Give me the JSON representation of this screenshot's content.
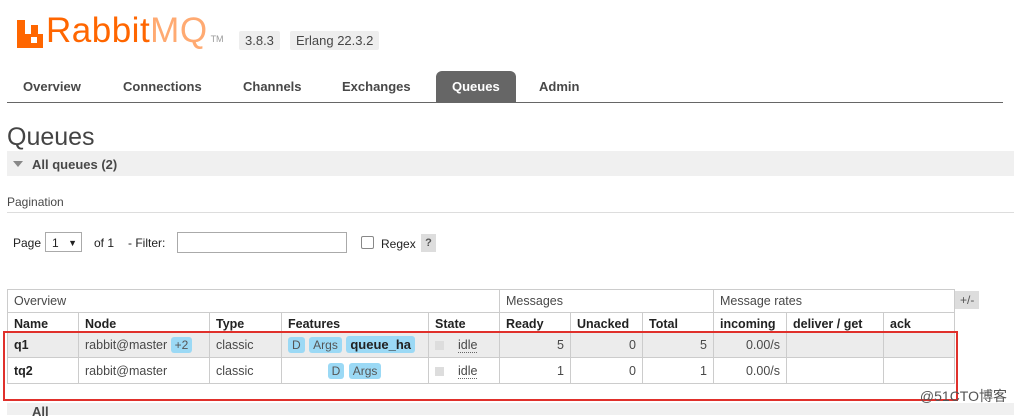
{
  "header": {
    "logo_text": "Rabbit",
    "logo_text_mq": "MQ",
    "logo_tm": "TM",
    "version": "3.8.3",
    "erlang": "Erlang 22.3.2"
  },
  "tabs": [
    {
      "label": "Overview",
      "active": false
    },
    {
      "label": "Connections",
      "active": false
    },
    {
      "label": "Channels",
      "active": false
    },
    {
      "label": "Exchanges",
      "active": false
    },
    {
      "label": "Queues",
      "active": true
    },
    {
      "label": "Admin",
      "active": false
    }
  ],
  "page": {
    "title": "Queues",
    "section": "All queues (2)",
    "pagination_label": "Pagination",
    "page_label": "Page",
    "page_value": "1",
    "page_of": "of 1",
    "filter_label": "- Filter:",
    "filter_value": "",
    "regex_label": "Regex",
    "help": "?",
    "plusminus": "+/-",
    "bottom_text": "All"
  },
  "table": {
    "groups": {
      "overview": "Overview",
      "messages": "Messages",
      "rates": "Message rates"
    },
    "columns": [
      "Name",
      "Node",
      "Type",
      "Features",
      "State",
      "Ready",
      "Unacked",
      "Total",
      "incoming",
      "deliver / get",
      "ack"
    ],
    "rows": [
      {
        "name": "q1",
        "node": "rabbit@master",
        "node_extra": "+2",
        "type": "classic",
        "features": [
          "D",
          "Args",
          "queue_ha"
        ],
        "state": "idle",
        "ready": "5",
        "unacked": "0",
        "total": "5",
        "incoming": "0.00/s",
        "deliver": "",
        "ack": ""
      },
      {
        "name": "tq2",
        "node": "rabbit@master",
        "node_extra": "",
        "type": "classic",
        "features": [
          "D",
          "Args"
        ],
        "state": "idle",
        "ready": "1",
        "unacked": "0",
        "total": "1",
        "incoming": "0.00/s",
        "deliver": "",
        "ack": ""
      }
    ]
  },
  "watermark": "@51CTO博客",
  "colors": {
    "brand": "#ff6600",
    "tab_active": "#666666",
    "tag": "#9bd9f5",
    "highlight": "#e0302b"
  }
}
